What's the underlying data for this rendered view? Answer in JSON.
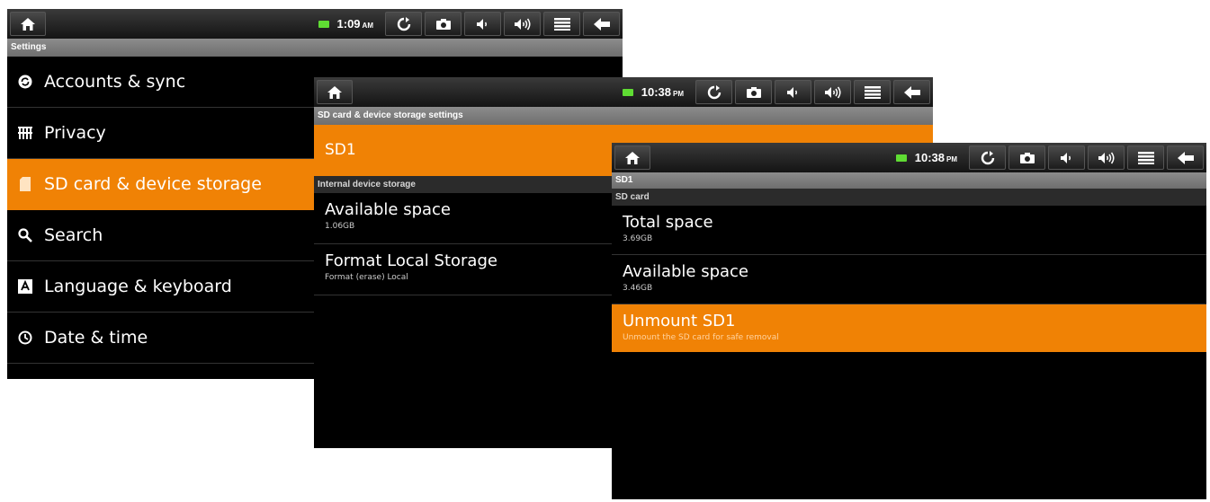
{
  "screen1": {
    "time": "1:09",
    "ampm": "AM",
    "title": "Settings",
    "items": [
      {
        "label": "Accounts & sync",
        "icon": "sync-circle-icon"
      },
      {
        "label": "Privacy",
        "icon": "privacy-grid-icon"
      },
      {
        "label": "SD card & device storage",
        "icon": "sd-card-icon",
        "selected": true
      },
      {
        "label": "Search",
        "icon": "search-icon"
      },
      {
        "label": "Language & keyboard",
        "icon": "language-icon"
      },
      {
        "label": "Date & time",
        "icon": "clock-icon"
      }
    ]
  },
  "screen2": {
    "time": "10:38",
    "ampm": "PM",
    "title": "SD card & device storage settings",
    "sd1_label": "SD1",
    "section": "Internal device storage",
    "items": [
      {
        "title": "Available space",
        "sub": "1.06GB"
      },
      {
        "title": "Format Local Storage",
        "sub": "Format (erase) Local"
      }
    ]
  },
  "screen3": {
    "time": "10:38",
    "ampm": "PM",
    "title": "SD1",
    "section": "SD card",
    "items": [
      {
        "title": "Total space",
        "sub": "3.69GB"
      },
      {
        "title": "Available space",
        "sub": "3.46GB"
      },
      {
        "title": "Unmount SD1",
        "sub": "Unmount the SD card for safe removal",
        "selected": true
      }
    ]
  },
  "colors": {
    "accent": "#f08205",
    "background": "#000000",
    "titlebar": "#7d7d7d"
  }
}
